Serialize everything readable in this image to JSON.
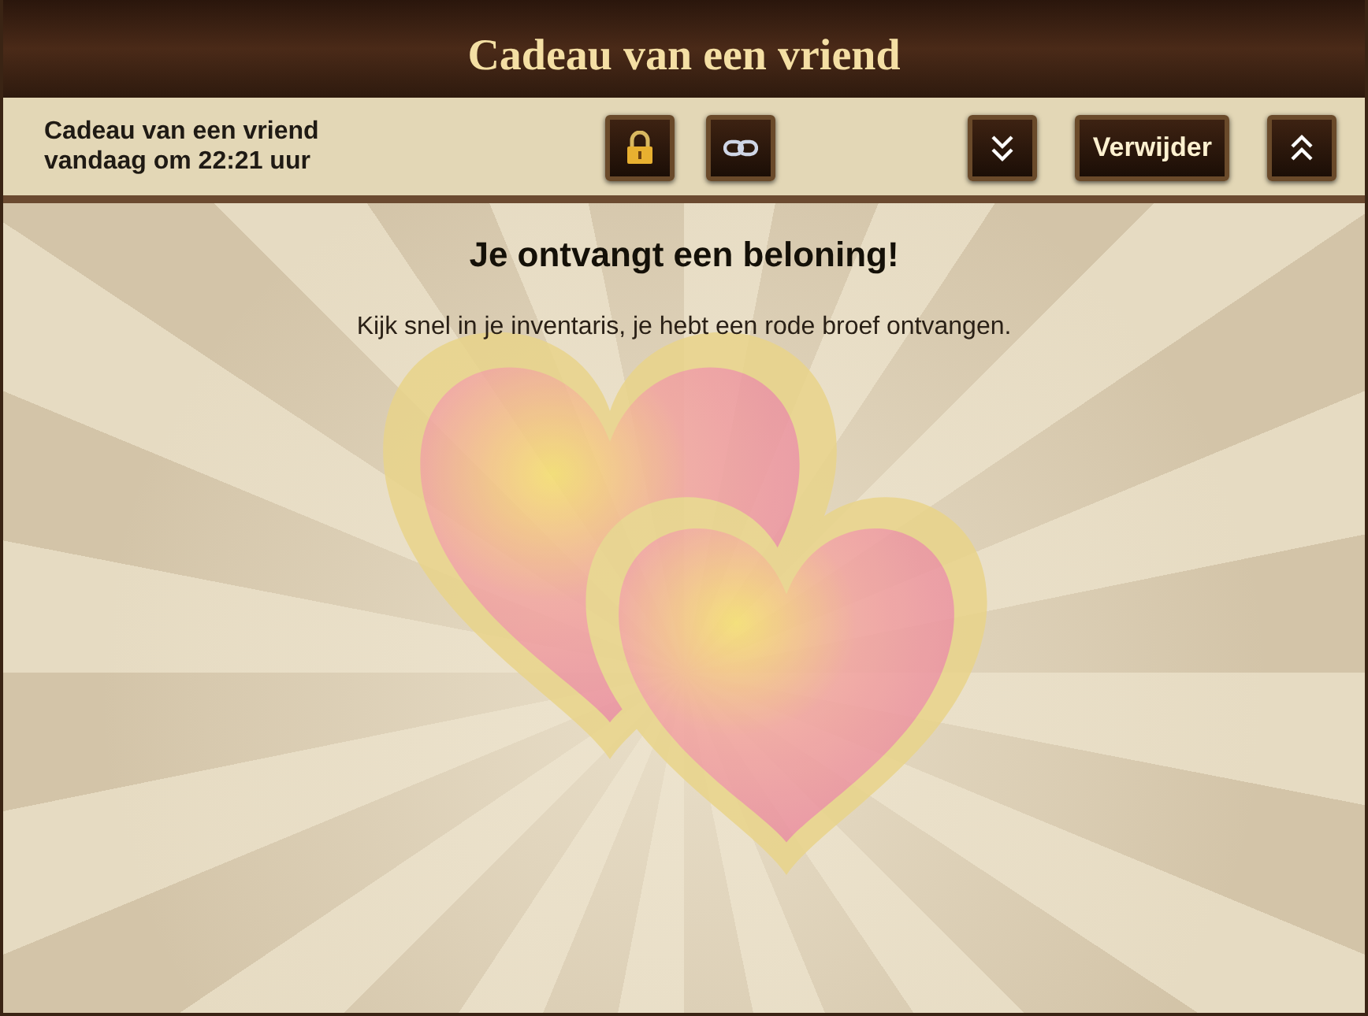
{
  "window": {
    "title": "Cadeau van een vriend"
  },
  "message": {
    "sender": "Cadeau van een vriend",
    "date": "vandaag om 22:21 uur"
  },
  "toolbar": {
    "delete_button": "Verwijder"
  },
  "content": {
    "heading": "Je ontvangt een beloning!",
    "body": "Kijk snel in je inventaris, je hebt een rode broef ontvangen."
  }
}
